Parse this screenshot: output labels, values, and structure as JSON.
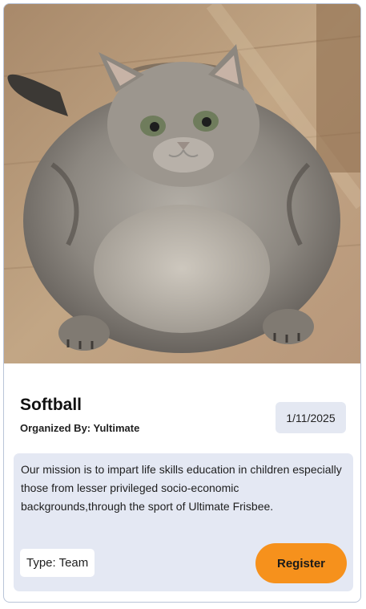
{
  "event": {
    "title": "Softball",
    "organizer": "Organized By: Yultimate",
    "date": "1/11/2025",
    "description": "Our mission is to impart life skills education in children especially those from lesser privileged socio-economic backgrounds,through the sport of Ultimate Frisbee.",
    "type": "Type: Team",
    "register_label": "Register",
    "image_subject": "cat-photo"
  },
  "colors": {
    "accent": "#f6911c",
    "panel": "#e4e8f3",
    "border": "#b9c4d8"
  }
}
